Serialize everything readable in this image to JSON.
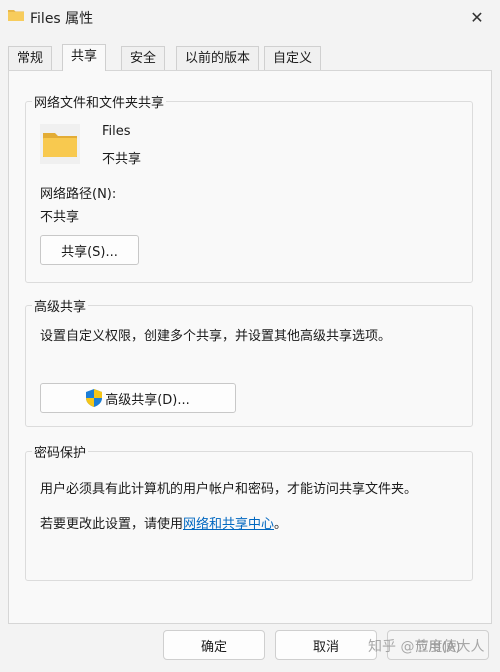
{
  "window": {
    "title": "Files 属性",
    "close_glyph": "✕"
  },
  "tabs": [
    {
      "label": "常规"
    },
    {
      "label": "共享"
    },
    {
      "label": "安全"
    },
    {
      "label": "以前的版本"
    },
    {
      "label": "自定义"
    }
  ],
  "network_share": {
    "group_title": "网络文件和文件夹共享",
    "item_name": "Files",
    "item_status": "不共享",
    "path_label": "网络路径(N):",
    "path_value": "不共享",
    "share_button": "共享(S)..."
  },
  "advanced_share": {
    "group_title": "高级共享",
    "description": "设置自定义权限，创建多个共享，并设置其他高级共享选项。",
    "button": "高级共享(D)..."
  },
  "password": {
    "group_title": "密码保护",
    "description": "用户必须具有此计算机的用户帐户和密码，才能访问共享文件夹。",
    "change_prefix": "若要更改此设置，请使用",
    "change_link": "网络和共享中心",
    "change_suffix": "。"
  },
  "footer": {
    "ok": "确定",
    "cancel": "取消",
    "apply": "应用(A)"
  },
  "watermark": "知乎 @节度使大人"
}
